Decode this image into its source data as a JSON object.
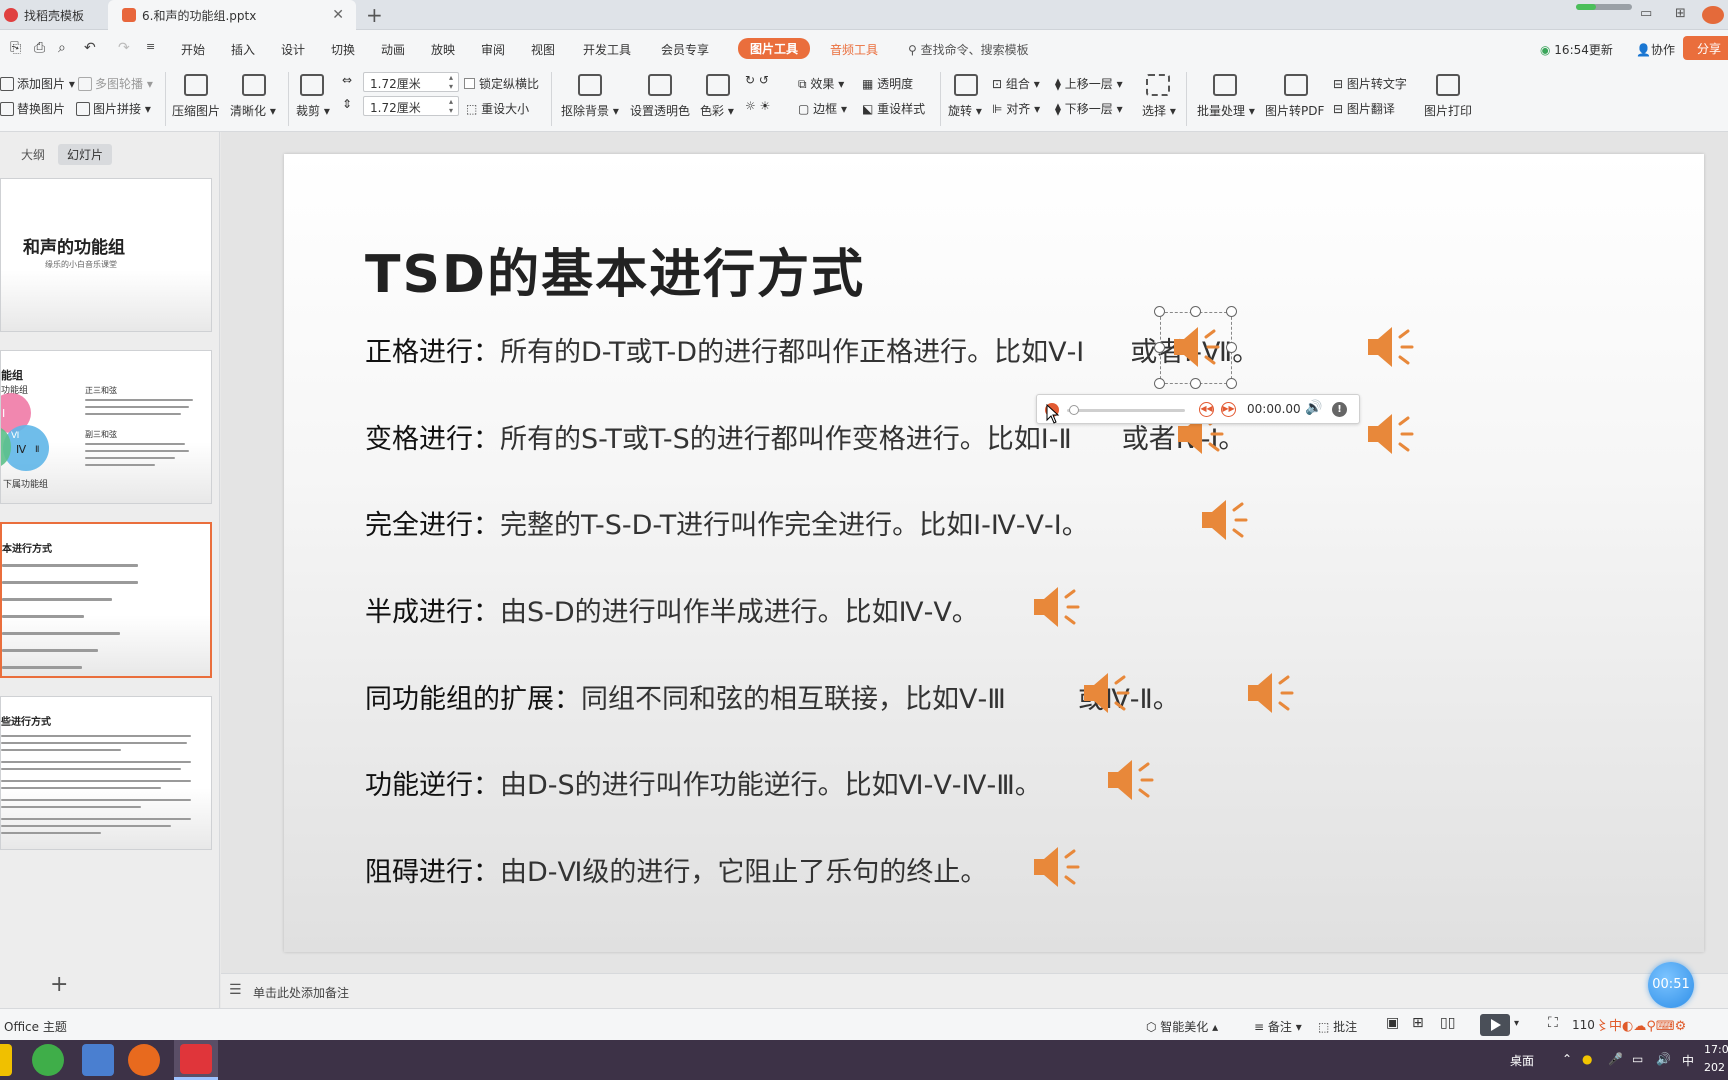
{
  "tabs": {
    "tab1_label": "找稻壳模板",
    "tab2_label": "6.和声的功能组.pptx",
    "add": "+"
  },
  "menu": {
    "items": [
      "开始",
      "插入",
      "设计",
      "切换",
      "动画",
      "放映",
      "审阅",
      "视图",
      "开发工具",
      "会员专享"
    ],
    "picture_tools": "图片工具",
    "audio_tools": "音频工具",
    "search_placeholder": "查找命令、搜索模板",
    "update_time": "16:54更新",
    "collab": "协作",
    "share": "分享"
  },
  "ribbon": {
    "add_picture": "添加图片",
    "multi_outline": "多图轮播",
    "replace_picture": "替换图片",
    "picture_stitch": "图片拼接",
    "compress": "压缩图片",
    "sharpen": "清晰化",
    "crop": "裁剪",
    "width_value": "1.72厘米",
    "height_value": "1.72厘米",
    "lock_ratio": "锁定纵横比",
    "reset_size": "重设大小",
    "remove_bg": "抠除背景",
    "set_transparent": "设置透明色",
    "color": "色彩",
    "effects": "效果",
    "transparency": "透明度",
    "border": "边框",
    "reset_style": "重设样式",
    "rotate": "旋转",
    "group": "组合",
    "align": "对齐",
    "bring_forward": "上移一层",
    "send_backward": "下移一层",
    "select": "选择",
    "batch": "批量处理",
    "to_pdf": "图片转PDF",
    "to_text": "图片转文字",
    "translate": "图片翻译",
    "print": "图片打印"
  },
  "left_panel": {
    "tab_outline": "大纲",
    "tab_slides": "幻灯片",
    "thumb1_title": "和声的功能组",
    "thumb1_sub": "缘乐的小白音乐课堂",
    "thumb2_title": "能组",
    "thumb2_sub1": "功能组",
    "thumb2_h1": "正三和弦",
    "thumb2_h2": "副三和弦",
    "thumb2_footer": "下属功能组",
    "thumb2_venn1": "I",
    "thumb2_venn2": "Ⅳ",
    "thumb2_venn3": "Ⅵ",
    "thumb2_venn4": "Ⅱ",
    "thumb3_title": "本进行方式",
    "thumb4_title": "些进行方式",
    "add_slide": "+"
  },
  "slide": {
    "title": "TSD的基本进行方式",
    "rows": [
      {
        "label": "正格进行：",
        "desc": "所有的D-T或T-D的进行都叫作正格进行。比如Ⅴ-Ⅰ",
        "mid": "或者Ⅰ-Ⅶ。"
      },
      {
        "label": "变格进行：",
        "desc": "所有的S-T或T-S的进行都叫作变格进行。比如Ⅰ-Ⅱ",
        "mid": "或者Ⅳ-Ⅰ。"
      },
      {
        "label": "完全进行：",
        "desc": "完整的T-S-D-T进行叫作完全进行。比如Ⅰ-Ⅳ-Ⅴ-Ⅰ。",
        "mid": ""
      },
      {
        "label": "半成进行：",
        "desc": "由S-D的进行叫作半成进行。比如Ⅳ-Ⅴ。",
        "mid": ""
      },
      {
        "label": "同功能组的扩展：",
        "desc": "同组不同和弦的相互联接，比如Ⅴ-Ⅲ",
        "mid": "或Ⅳ-Ⅱ。"
      },
      {
        "label": "功能逆行：",
        "desc": "由D-S的进行叫作功能逆行。比如Ⅵ-Ⅴ-Ⅳ-Ⅲ。",
        "mid": ""
      },
      {
        "label": "阻碍进行：",
        "desc": "由D-Ⅵ级的进行，它阻止了乐句的终止。",
        "mid": ""
      }
    ],
    "player_time": "00:00.00"
  },
  "notes": {
    "placeholder": "单击此处添加备注",
    "timer": "00:51"
  },
  "status": {
    "theme": "Office 主题",
    "smart": "智能美化",
    "notes": "备注",
    "comment": "批注",
    "zoom": "110"
  },
  "taskbar": {
    "desktop": "桌面",
    "ime": "中",
    "clock": "17:0",
    "date": "202"
  },
  "colors": {
    "accent": "#ea6e3c",
    "speaker": "#e8883a"
  }
}
